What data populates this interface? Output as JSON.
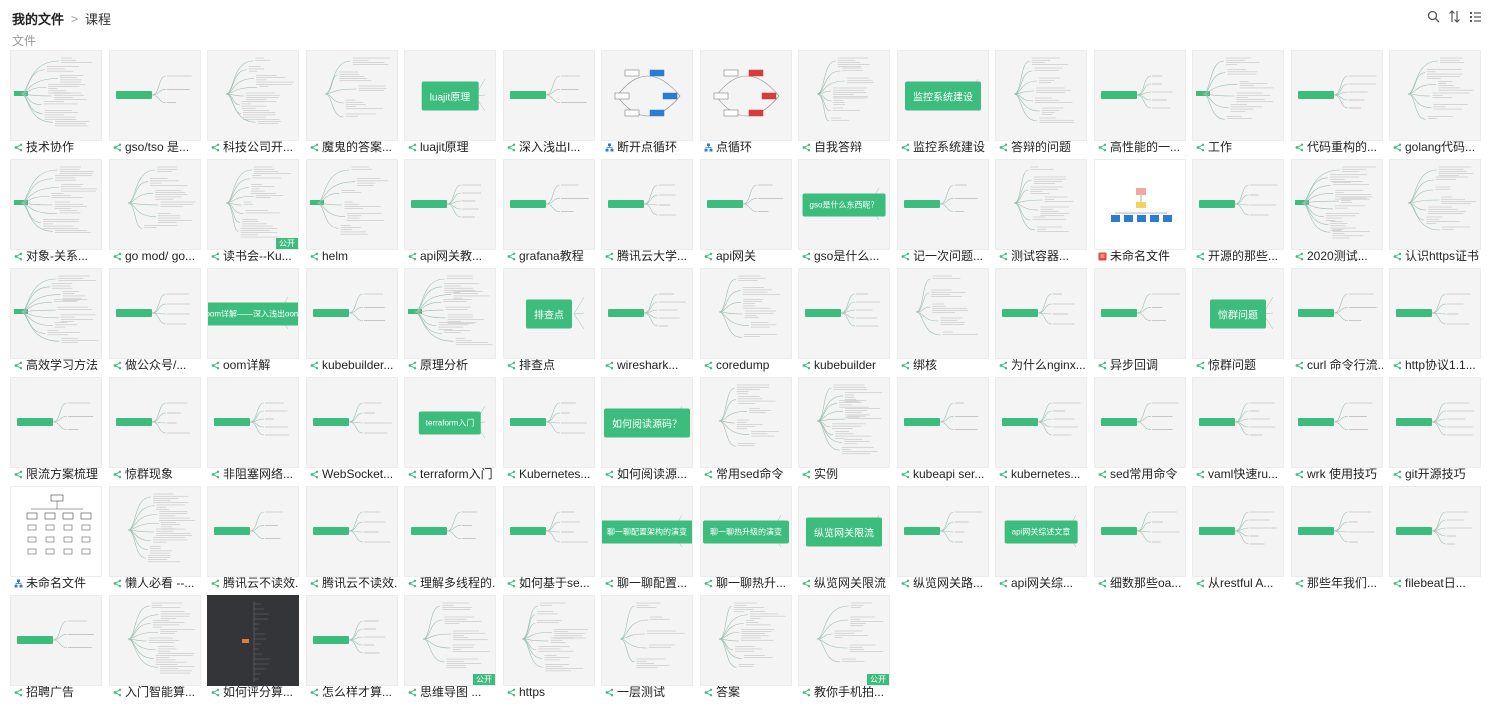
{
  "breadcrumb": {
    "root": "我的文件",
    "separator": ">",
    "current": "课程"
  },
  "section_title": "文件",
  "toolbar": {
    "icons": [
      "search-icon",
      "sort-icon",
      "list-view-icon"
    ]
  },
  "colors": {
    "accent": "#3dbd7d",
    "mindmap_icon": "#3dbd7d",
    "flowchart_icon": "#2b7cd3",
    "doc_icon": "#e6483d"
  },
  "badge_text": "公开",
  "files": [
    {
      "name": "技术协作",
      "kind": "mindmap",
      "style": "tree"
    },
    {
      "name": "gso/tso 是...",
      "kind": "mindmap",
      "style": "pill-small"
    },
    {
      "name": "科技公司开...",
      "kind": "mindmap",
      "style": "lines"
    },
    {
      "name": "魔鬼的答案...",
      "kind": "mindmap",
      "style": "lines"
    },
    {
      "name": "luajit原理",
      "kind": "mindmap",
      "style": "pill",
      "pill": "luajit原理"
    },
    {
      "name": "深入浅出I...",
      "kind": "mindmap",
      "style": "pill-small"
    },
    {
      "name": "断开点循环",
      "kind": "flowchart",
      "style": "flow-blue"
    },
    {
      "name": "点循环",
      "kind": "flowchart",
      "style": "flow-red"
    },
    {
      "name": "自我答辩",
      "kind": "mindmap",
      "style": "lines"
    },
    {
      "name": "监控系统建设",
      "kind": "mindmap",
      "style": "pill",
      "pill": "监控系统建设"
    },
    {
      "name": "答辩的问题",
      "kind": "mindmap",
      "style": "lines"
    },
    {
      "name": "高性能的一...",
      "kind": "mindmap",
      "style": "pill-small"
    },
    {
      "name": "工作",
      "kind": "mindmap",
      "style": "tree"
    },
    {
      "name": "代码重构的...",
      "kind": "mindmap",
      "style": "pill-small"
    },
    {
      "name": "golang代码...",
      "kind": "mindmap",
      "style": "lines"
    },
    {
      "name": "对象-关系...",
      "kind": "mindmap",
      "style": "tree"
    },
    {
      "name": "go mod/ go...",
      "kind": "mindmap",
      "style": "lines"
    },
    {
      "name": "读书会--Ku...",
      "kind": "mindmap",
      "style": "lines",
      "badge": true
    },
    {
      "name": "helm",
      "kind": "mindmap",
      "style": "tree"
    },
    {
      "name": "api网关教...",
      "kind": "mindmap",
      "style": "pill-small"
    },
    {
      "name": "grafana教程",
      "kind": "mindmap",
      "style": "pill-small"
    },
    {
      "name": "腾讯云大学...",
      "kind": "mindmap",
      "style": "pill-small"
    },
    {
      "name": "api网关",
      "kind": "mindmap",
      "style": "pill-small"
    },
    {
      "name": "gso是什么...",
      "kind": "mindmap",
      "style": "pill",
      "pill": "gso是什么东西呢？"
    },
    {
      "name": "记一次问题...",
      "kind": "mindmap",
      "style": "pill-small"
    },
    {
      "name": "测试容器...",
      "kind": "mindmap",
      "style": "lines"
    },
    {
      "name": "未命名文件",
      "kind": "doc",
      "style": "org",
      "white": true
    },
    {
      "name": "开源的那些...",
      "kind": "mindmap",
      "style": "pill-small"
    },
    {
      "name": "2020测试...",
      "kind": "mindmap",
      "style": "tree"
    },
    {
      "name": "认识https证书",
      "kind": "mindmap",
      "style": "lines"
    },
    {
      "name": "高效学习方法",
      "kind": "mindmap",
      "style": "tree"
    },
    {
      "name": "做公众号/...",
      "kind": "mindmap",
      "style": "pill-small"
    },
    {
      "name": "oom详解",
      "kind": "mindmap",
      "style": "pill",
      "pill": "oom详解——深入浅出oom"
    },
    {
      "name": "kubebuilder...",
      "kind": "mindmap",
      "style": "pill-small"
    },
    {
      "name": "原理分析",
      "kind": "mindmap",
      "style": "tree"
    },
    {
      "name": "排查点",
      "kind": "mindmap",
      "style": "pill",
      "pill": "排查点"
    },
    {
      "name": "wireshark...",
      "kind": "mindmap",
      "style": "pill-small"
    },
    {
      "name": "coredump",
      "kind": "mindmap",
      "style": "lines"
    },
    {
      "name": "kubebuilder",
      "kind": "mindmap",
      "style": "pill-small"
    },
    {
      "name": "绑核",
      "kind": "mindmap",
      "style": "lines"
    },
    {
      "name": "为什么nginx...",
      "kind": "mindmap",
      "style": "pill-small"
    },
    {
      "name": "异步回调",
      "kind": "mindmap",
      "style": "pill-small"
    },
    {
      "name": "惊群问题",
      "kind": "mindmap",
      "style": "pill",
      "pill": "惊群问题"
    },
    {
      "name": "curl 命令行流...",
      "kind": "mindmap",
      "style": "pill-small"
    },
    {
      "name": "http协议1.1...",
      "kind": "mindmap",
      "style": "pill-small"
    },
    {
      "name": "限流方案梳理",
      "kind": "mindmap",
      "style": "pill-small"
    },
    {
      "name": "惊群现象",
      "kind": "mindmap",
      "style": "pill-small"
    },
    {
      "name": "非阻塞网络...",
      "kind": "mindmap",
      "style": "pill-small"
    },
    {
      "name": "WebSocket...",
      "kind": "mindmap",
      "style": "pill-small"
    },
    {
      "name": "terraform入门",
      "kind": "mindmap",
      "style": "pill",
      "pill": "terraform入门"
    },
    {
      "name": "Kubernetes...",
      "kind": "mindmap",
      "style": "pill-small"
    },
    {
      "name": "如何阅读源...",
      "kind": "mindmap",
      "style": "pill",
      "pill": "如何阅读源码？"
    },
    {
      "name": "常用sed命令",
      "kind": "mindmap",
      "style": "lines"
    },
    {
      "name": "实例",
      "kind": "mindmap",
      "style": "lines"
    },
    {
      "name": "kubeapi ser...",
      "kind": "mindmap",
      "style": "pill-small"
    },
    {
      "name": "kubernetes...",
      "kind": "mindmap",
      "style": "pill-small"
    },
    {
      "name": "sed常用命令",
      "kind": "mindmap",
      "style": "pill-small"
    },
    {
      "name": "vaml快速ru...",
      "kind": "mindmap",
      "style": "pill-small"
    },
    {
      "name": "wrk 使用技巧",
      "kind": "mindmap",
      "style": "pill-small"
    },
    {
      "name": "git开源技巧",
      "kind": "mindmap",
      "style": "pill-small"
    },
    {
      "name": "未命名文件",
      "kind": "flowchart",
      "style": "org-tree",
      "white": true
    },
    {
      "name": "懒人必看 --...",
      "kind": "mindmap",
      "style": "lines"
    },
    {
      "name": "腾讯云不读效...",
      "kind": "mindmap",
      "style": "pill-small"
    },
    {
      "name": "腾讯云不读效...",
      "kind": "mindmap",
      "style": "pill-small"
    },
    {
      "name": "理解多线程的...",
      "kind": "mindmap",
      "style": "pill-small"
    },
    {
      "name": "如何基于se...",
      "kind": "mindmap",
      "style": "pill-small"
    },
    {
      "name": "聊一聊配置...",
      "kind": "mindmap",
      "style": "pill",
      "pill": "聊一聊配置架构的演变"
    },
    {
      "name": "聊一聊热升...",
      "kind": "mindmap",
      "style": "pill",
      "pill": "聊一聊热升级的演变"
    },
    {
      "name": "纵览网关限流",
      "kind": "mindmap",
      "style": "pill",
      "pill": "纵览网关限流"
    },
    {
      "name": "纵览网关路...",
      "kind": "mindmap",
      "style": "pill-small"
    },
    {
      "name": "api网关综...",
      "kind": "mindmap",
      "style": "pill",
      "pill": "api网关综述文章"
    },
    {
      "name": "细数那些oa...",
      "kind": "mindmap",
      "style": "pill-small"
    },
    {
      "name": "从restful A...",
      "kind": "mindmap",
      "style": "pill-small"
    },
    {
      "name": "那些年我们...",
      "kind": "mindmap",
      "style": "pill-small"
    },
    {
      "name": "filebeat日...",
      "kind": "mindmap",
      "style": "pill-small"
    },
    {
      "name": "招聘广告",
      "kind": "mindmap",
      "style": "pill-small"
    },
    {
      "name": "入门智能算...",
      "kind": "mindmap",
      "style": "lines"
    },
    {
      "name": "如何评分算...",
      "kind": "mindmap",
      "style": "dark",
      "dark": true
    },
    {
      "name": "怎么样才算...",
      "kind": "mindmap",
      "style": "pill-small"
    },
    {
      "name": "思维导图 ...",
      "kind": "mindmap",
      "style": "lines",
      "badge": true
    },
    {
      "name": "https",
      "kind": "mindmap",
      "style": "lines"
    },
    {
      "name": "一层测试",
      "kind": "mindmap",
      "style": "lines"
    },
    {
      "name": "答案",
      "kind": "mindmap",
      "style": "lines"
    },
    {
      "name": "教你手机拍...",
      "kind": "mindmap",
      "style": "lines",
      "badge": true
    }
  ]
}
